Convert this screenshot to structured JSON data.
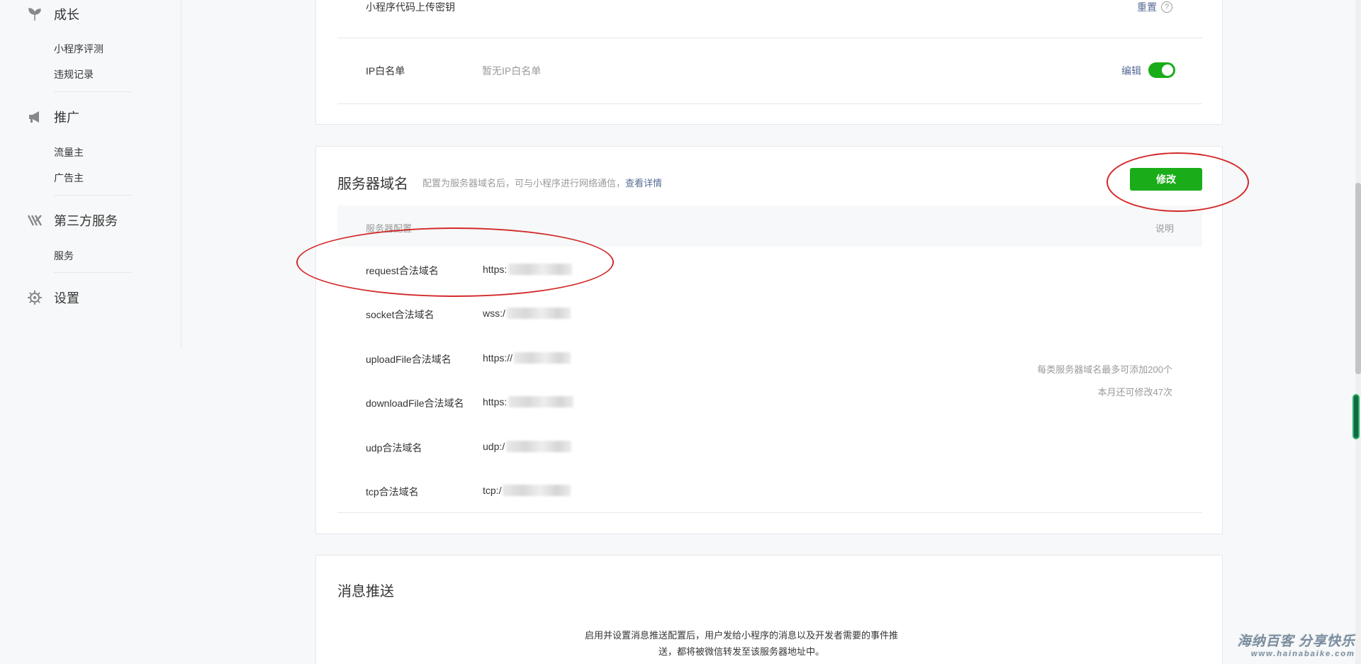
{
  "sidebar": {
    "sections": [
      {
        "label": "成长",
        "icon": "leaf-icon",
        "items": [
          "小程序评测",
          "违规记录"
        ]
      },
      {
        "label": "推广",
        "icon": "megaphone-icon",
        "items": [
          "流量主",
          "广告主"
        ]
      },
      {
        "label": "第三方服务",
        "icon": "third-party-icon",
        "items": [
          "服务"
        ]
      },
      {
        "label": "设置",
        "icon": "gear-icon",
        "items": []
      }
    ]
  },
  "dev_settings": {
    "secret_label": "小程序代码上传密钥",
    "secret_action": "重置",
    "help_glyph": "?",
    "ip_label": "IP白名单",
    "ip_value": "暂无IP白名单",
    "ip_action": "编辑",
    "ip_toggle_on": true
  },
  "server_domain": {
    "title": "服务器域名",
    "description": "配置为服务器域名后，可与小程序进行网络通信，",
    "description_link": "查看详情",
    "modify_button": "修改",
    "header_config": "服务器配置",
    "header_note": "说明",
    "rows": [
      {
        "label": "request合法域名",
        "value": "https:"
      },
      {
        "label": "socket合法域名",
        "value": "wss:/"
      },
      {
        "label": "uploadFile合法域名",
        "value": "https://"
      },
      {
        "label": "downloadFile合法域名",
        "value": "https:"
      },
      {
        "label": "udp合法域名",
        "value": "udp:/"
      },
      {
        "label": "tcp合法域名",
        "value": "tcp:/"
      }
    ],
    "note_line1": "每类服务器域名最多可添加200个",
    "note_line2": "本月还可修改47次"
  },
  "message_push": {
    "title": "消息推送",
    "line1": "启用并设置消息推送配置后，用户发给小程序的消息以及开发者需要的事件推",
    "line2": "送，都将被微信转发至该服务器地址中。"
  },
  "watermark": {
    "line1": "海纳百客 分享快乐",
    "line2": "www.hainabaike.com"
  },
  "colors": {
    "accent_green": "#1aad19",
    "link_blue": "#576b95",
    "annotation_red": "#d42a2a"
  }
}
